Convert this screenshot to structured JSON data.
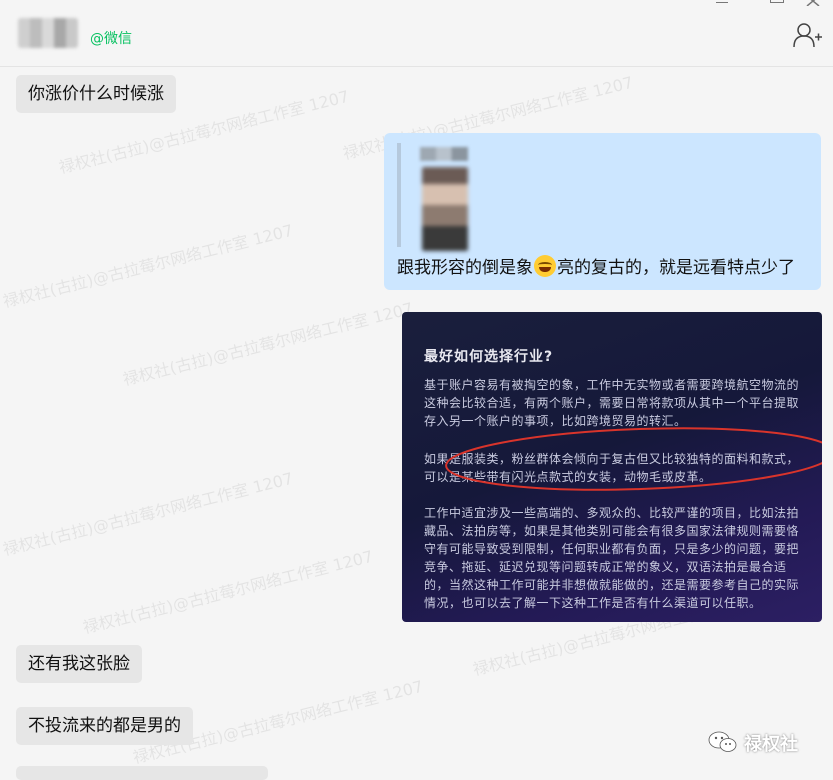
{
  "header": {
    "chat_source": "@微信"
  },
  "messages": [
    {
      "side": "left",
      "text": "你涨价什么时候涨"
    },
    {
      "side": "right",
      "text_before_emoji": "跟我形容的倒是象",
      "emoji": "grinning-face-emoji",
      "text_after_emoji": "亮的复古的，就是远看特点少了"
    },
    {
      "side": "right",
      "type": "image"
    },
    {
      "side": "left",
      "text": "还有我这张脸"
    },
    {
      "side": "left",
      "text": "不投流来的都是男的"
    }
  ],
  "image_card": {
    "title": "最好如何选择行业?",
    "paragraphs": [
      "基于账户容易有被掏空的象，工作中无实物或者需要跨境航空物流的这种会比较合适，有两个账户，需要日常将款项从其中一个平台提取存入另一个账户的事项，比如跨境贸易的转汇。",
      "如果是服装类，粉丝群体会倾向于复古但又比较独特的面料和款式，可以是某些带有闪光点款式的女装，动物毛或皮革。",
      "工作中适宜涉及一些高端的、多观众的、比较严谨的项目，比如法拍藏品、法拍房等，如果是其他类别可能会有很多国家法律规则需要恪守有可能导致受到限制，任何职业都有负面，只是多少的问题，要把竞争、拖延、延迟兑现等问题转成正常的象义，双语法拍是最合适的，当然这种工作可能并非想做就能做的，还是需要参考自己的实际情况，也可以去了解一下这种工作是否有什么渠道可以任职。"
    ],
    "annotation_color": "#d9342b"
  },
  "watermark_text": "禄权社(古拉)@古拉莓尔网络工作室 1207",
  "brand": {
    "name": "禄权社",
    "icon": "wechat-official-account-icon"
  },
  "colors": {
    "source_green": "#07c160",
    "right_bubble": "#cce6ff",
    "left_bubble": "#e6e6e6"
  }
}
